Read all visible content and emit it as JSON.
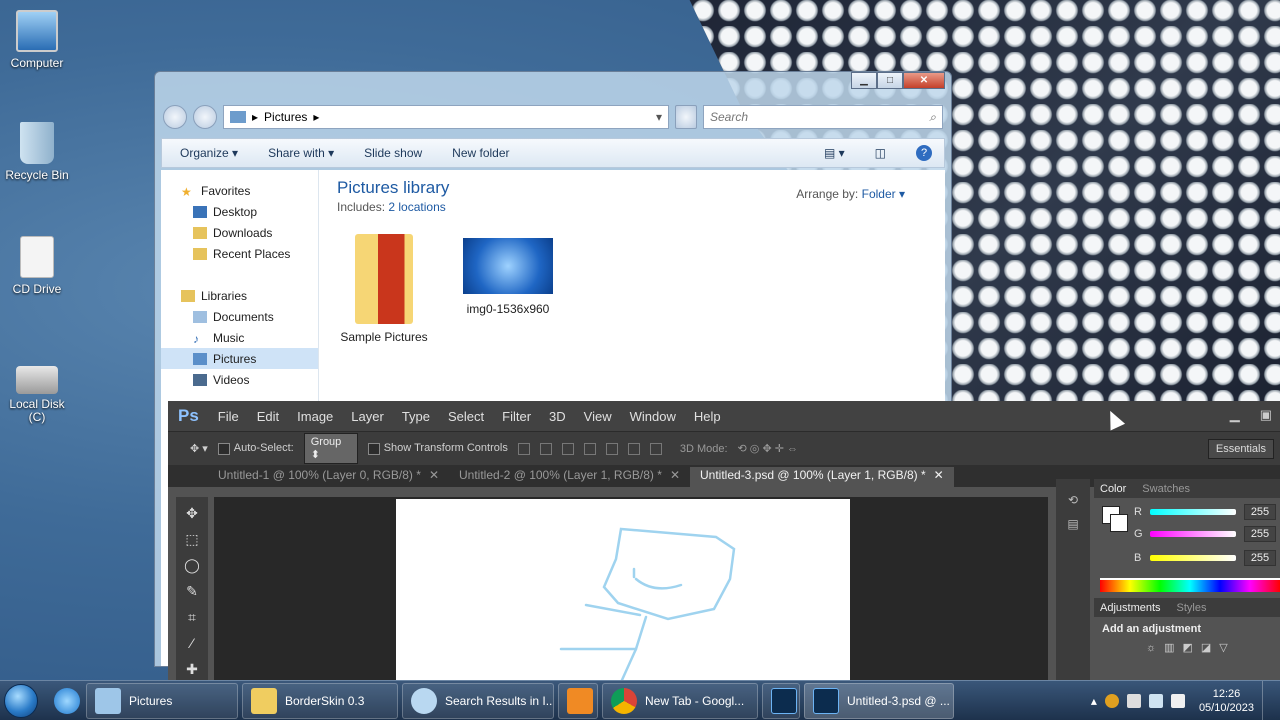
{
  "desktop": {
    "icons": [
      {
        "label": "Computer"
      },
      {
        "label": "Recycle Bin"
      },
      {
        "label": "CD Drive"
      },
      {
        "label": "Local Disk\n(C)"
      }
    ]
  },
  "explorer": {
    "address_crumb": "Pictures",
    "search_placeholder": "Search",
    "toolbar": {
      "organize": "Organize",
      "share_with": "Share with",
      "slide_show": "Slide show",
      "new_folder": "New folder"
    },
    "nav": {
      "favorites": "Favorites",
      "desktop": "Desktop",
      "downloads": "Downloads",
      "recent_places": "Recent Places",
      "libraries": "Libraries",
      "documents": "Documents",
      "music": "Music",
      "pictures": "Pictures",
      "videos": "Videos"
    },
    "library_title": "Pictures library",
    "includes_label": "Includes:",
    "includes_link": "2 locations",
    "arrange_label": "Arrange by:",
    "arrange_value": "Folder",
    "items": [
      {
        "label": "Sample Pictures"
      },
      {
        "label": "img0-1536x960"
      }
    ]
  },
  "photoshop": {
    "logo": "Ps",
    "menu": [
      "File",
      "Edit",
      "Image",
      "Layer",
      "Type",
      "Select",
      "Filter",
      "3D",
      "View",
      "Window",
      "Help"
    ],
    "options": {
      "auto_select": "Auto-Select:",
      "group": "Group",
      "show_transform": "Show Transform Controls",
      "mode_3d": "3D Mode:",
      "workspace": "Essentials"
    },
    "tabs": [
      {
        "label": "Untitled-1 @ 100% (Layer 0, RGB/8) *"
      },
      {
        "label": "Untitled-2 @ 100% (Layer 1, RGB/8) *"
      },
      {
        "label": "Untitled-3.psd @ 100% (Layer 1, RGB/8) *"
      }
    ],
    "color_panel": {
      "tab_color": "Color",
      "tab_swatches": "Swatches",
      "r_label": "R",
      "g_label": "G",
      "b_label": "B",
      "r_value": "255",
      "g_value": "255",
      "b_value": "255"
    },
    "adjust_panel": {
      "tab_adjustments": "Adjustments",
      "tab_styles": "Styles",
      "add_label": "Add an adjustment"
    }
  },
  "taskbar": {
    "items": [
      {
        "label": "Pictures"
      },
      {
        "label": "BorderSkin 0.3"
      },
      {
        "label": "Search Results in I..."
      },
      {
        "label": "New Tab - Googl..."
      },
      {
        "label": "Untitled-3.psd @ ..."
      }
    ],
    "time": "12:26",
    "date": "05/10/2023"
  }
}
